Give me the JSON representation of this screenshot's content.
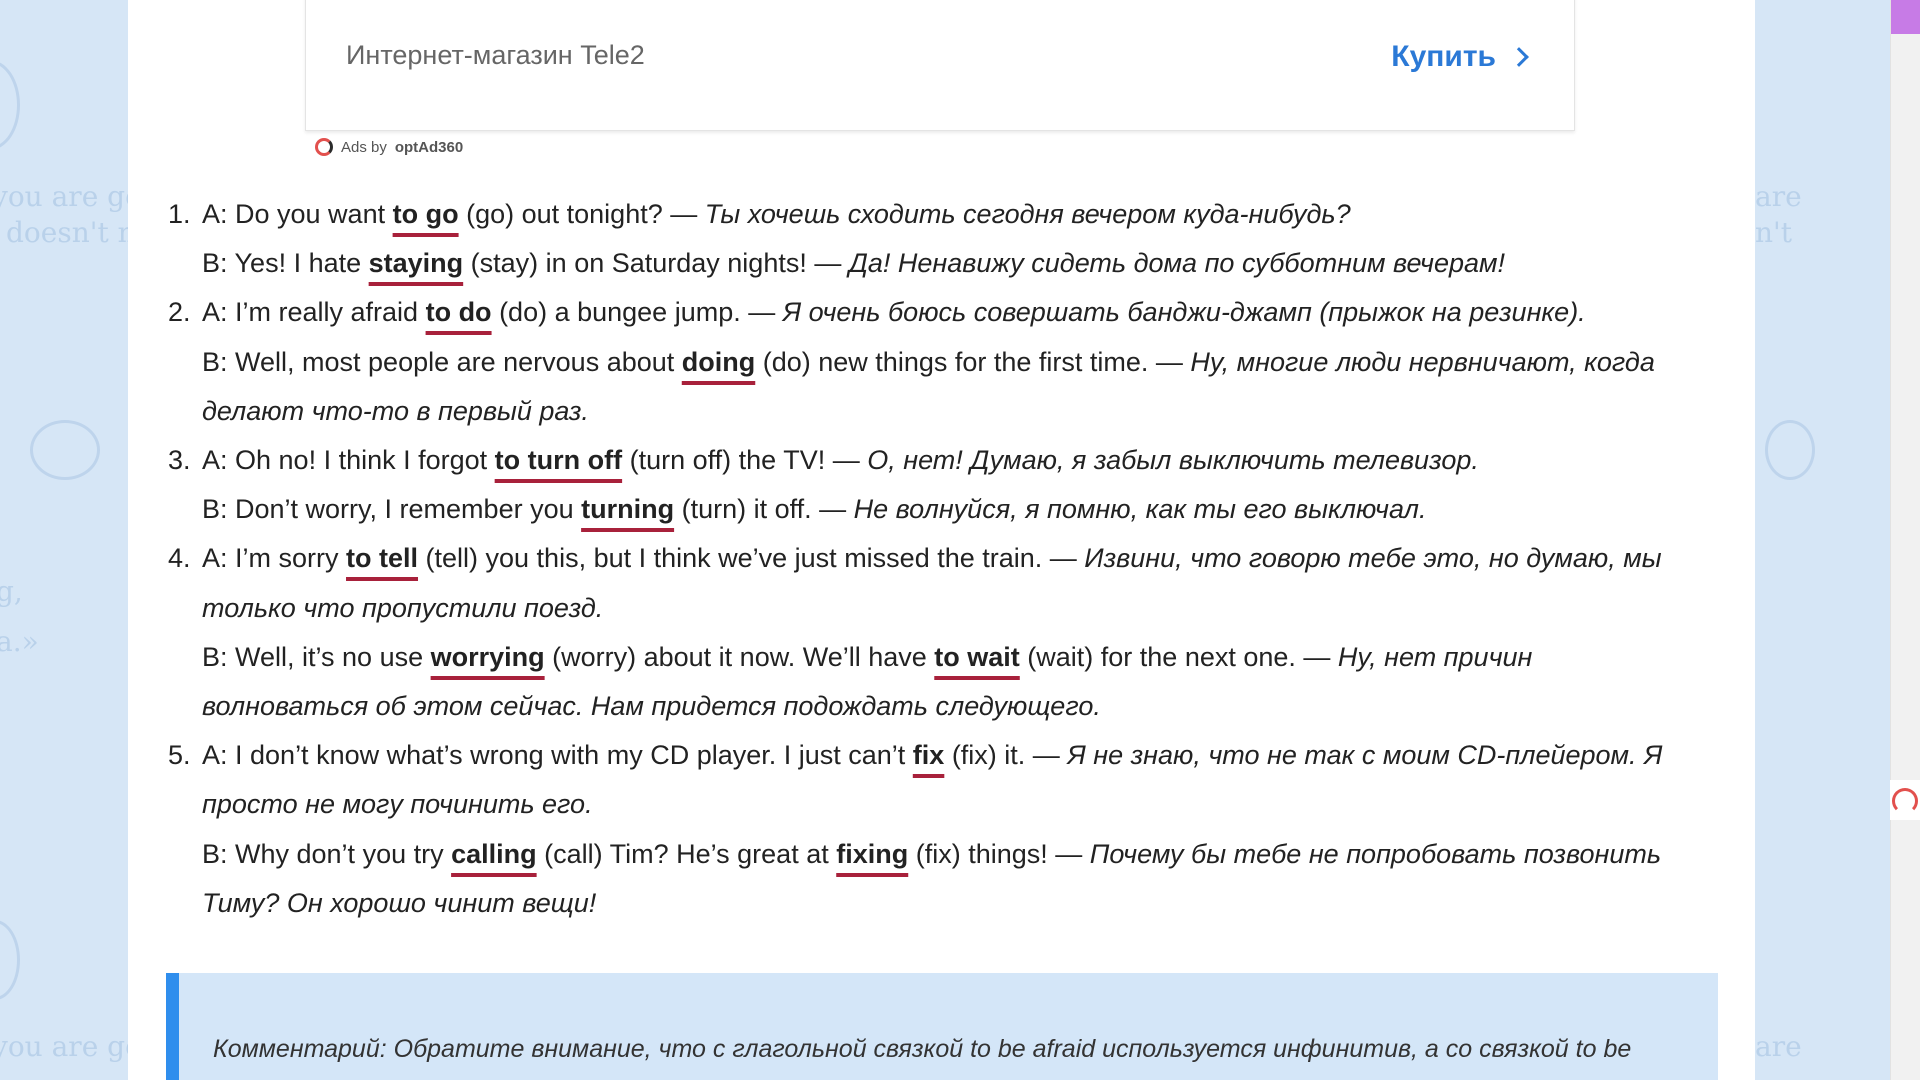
{
  "ad": {
    "title": "Интернет-магазин Tele2",
    "buy_label": "Купить",
    "ads_by_prefix": "Ads by",
    "ads_by_brand": "optAd360"
  },
  "exercises": [
    {
      "number": "1.",
      "a": {
        "pre": "A: Do you want ",
        "answer": "to go",
        "post": " (go) out tonight? — ",
        "ru": "Ты хочешь сходить сегодня вечером куда-нибудь?"
      },
      "b": [
        {
          "pre": "B: Yes! I hate ",
          "answer": "staying",
          "post": " (stay) in on Saturday nights! — ",
          "ru": "Да! Ненавижу сидеть дома по субботним вечерам!"
        }
      ]
    },
    {
      "number": "2.",
      "a": {
        "pre": "A: I’m really afraid ",
        "answer": "to do",
        "post": " (do) a bungee jump. — ",
        "ru": "Я очень боюсь совершать банджи-джамп (прыжок на резинке)."
      },
      "b": [
        {
          "pre": "B: Well, most people are nervous about ",
          "answer": "doing",
          "post": " (do) new things for the first time. — ",
          "ru": "Ну, многие люди нервничают, когда делают что-то в первый раз."
        }
      ]
    },
    {
      "number": "3.",
      "a": {
        "pre": "A: Oh no! I think I forgot ",
        "answer": "to turn off",
        "post": " (turn off) the TV! — ",
        "ru": "О, нет! Думаю, я забыл выключить телевизор."
      },
      "b": [
        {
          "pre": "B: Don’t worry, I remember you ",
          "answer": "turning",
          "post": " (turn) it off. — ",
          "ru": "Не волнуйся, я помню, как ты его выключал."
        }
      ]
    },
    {
      "number": "4.",
      "a": {
        "pre": "A: I’m sorry ",
        "answer": "to tell",
        "post": " (tell) you this, but I think we’ve just missed the train. — ",
        "ru": "Извини, что говорю тебе это, но думаю, мы только что пропустили поезд."
      },
      "b": [
        {
          "pre": "B: Well, it’s no use ",
          "answer": "worrying",
          "mid": " (worry) about it now. We’ll have ",
          "answer2": "to wait",
          "post": " (wait) for the next one. — ",
          "ru": "Ну, нет причин волноваться об этом сейчас. Нам придется подождать следующего."
        }
      ]
    },
    {
      "number": "5.",
      "a": {
        "pre": "A: I don’t know what’s wrong with my CD player. I just can’t ",
        "answer": "fix",
        "post": " (fix) it. — ",
        "ru": "Я не знаю, что не так с моим CD-плейером. Я просто не могу починить его."
      },
      "b": [
        {
          "pre": "B: Why don’t you try ",
          "answer": "calling",
          "mid": " (call) Tim? He’s great at ",
          "answer2": "fixing",
          "post": " (fix) things! — ",
          "ru": "Почему бы тебе не попробовать позвонить Тиму? Он хорошо чинит вещи!"
        }
      ]
    }
  ],
  "comment": {
    "text": "Комментарий: Обратите внимание, что с глагольной связкой to be afraid используется инфинитив, а со связкой to be"
  },
  "background": {
    "left_texts": [
      "you are go",
      "doesn't ma",
      "g,",
      "a.»"
    ],
    "right_texts": [
      "are",
      "n't",
      "are"
    ]
  },
  "colors": {
    "accent_blue": "#2f8eed",
    "link_blue": "#2b79d6",
    "underline_red": "#a8213b",
    "comment_bg": "#d4e6f8",
    "scroll_thumb": "#c77be6"
  }
}
